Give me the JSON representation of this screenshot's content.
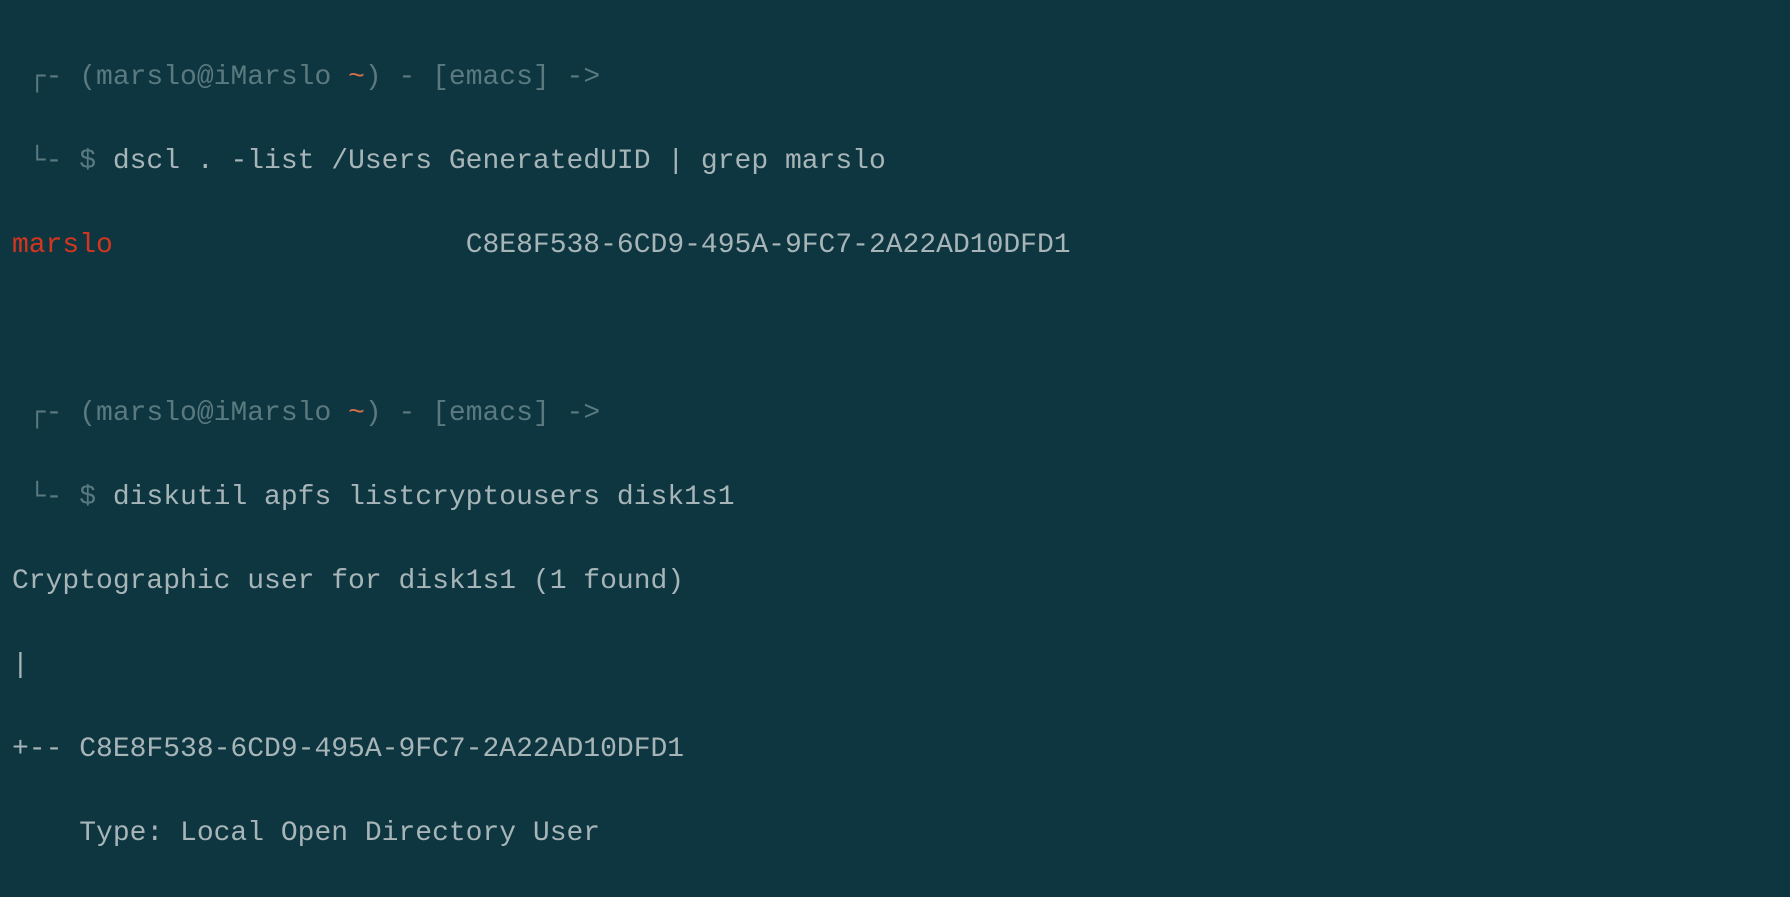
{
  "prompt1": {
    "bracket_top": " ┌- ",
    "bracket_bottom": " └- ",
    "user_host": "(marslo@iMarslo ",
    "tilde": "~",
    "user_host_end": ") - ",
    "context": "[emacs]",
    "arrow": " ->",
    "symbol": "$ ",
    "command": "dscl . -list /Users GeneratedUID | grep marslo"
  },
  "output1": {
    "match": "marslo",
    "spaces": "                     ",
    "uuid": "C8E8F538-6CD9-495A-9FC7-2A22AD10DFD1"
  },
  "prompt2": {
    "bracket_top": " ┌- ",
    "bracket_bottom": " └- ",
    "user_host": "(marslo@iMarslo ",
    "tilde": "~",
    "user_host_end": ") - ",
    "context": "[emacs]",
    "arrow": " ->",
    "symbol": "$ ",
    "command": "diskutil apfs listcryptousers disk1s1"
  },
  "output2": {
    "line1": "Cryptographic user for disk1s1 (1 found)",
    "line2": "|",
    "line3": "+-- C8E8F538-6CD9-495A-9FC7-2A22AD10DFD1",
    "line4": "    Type: Local Open Directory User"
  }
}
